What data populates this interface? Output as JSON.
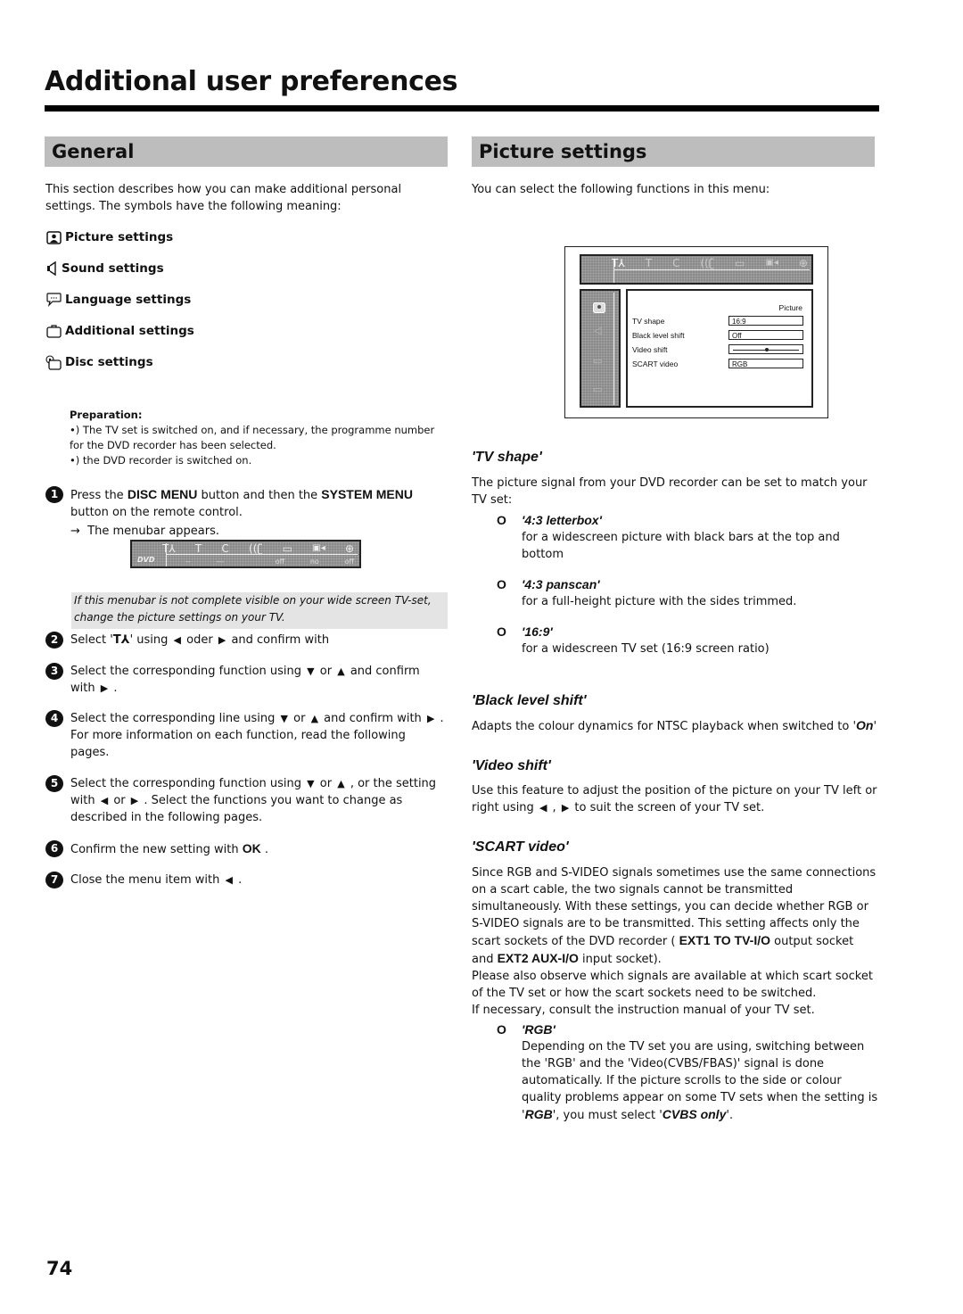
{
  "page": {
    "title": "Additional user preferences",
    "page_number": "74"
  },
  "general": {
    "heading": "General",
    "intro": "This section describes how you can make additional personal settings. The symbols have the following meaning:",
    "symbols": [
      {
        "icon": "picture-icon",
        "label": "Picture settings"
      },
      {
        "icon": "speaker-icon",
        "label": "Sound settings"
      },
      {
        "icon": "speech-bubble-icon",
        "label": "Language settings"
      },
      {
        "icon": "briefcase-icon",
        "label": "Additional settings"
      },
      {
        "icon": "disc-icon",
        "label": "Disc settings"
      }
    ],
    "preparation": {
      "label": "Preparation:",
      "lines": [
        "•) The TV set is switched on, and if necessary, the programme number for the DVD recorder has been selected.",
        "•) the DVD recorder is switched on."
      ]
    },
    "steps": [
      {
        "num": "1",
        "parts": [
          "Press the ",
          "DISC MENU",
          " button and then the ",
          "SYSTEM MENU",
          " button on the remote control."
        ],
        "result": "The menubar appears."
      },
      {
        "num": "2",
        "text_a": "Select '",
        "glyph": "T⅄",
        "text_b": "' using ",
        "left": "◀",
        "mid": " oder ",
        "right": "▶",
        "text_c": " and confirm with"
      },
      {
        "num": "3",
        "text_a": "Select the corresponding function using ",
        "down": "▼",
        "or": " or ",
        "up": "▲",
        "text_b": " and confirm with ",
        "right": "▶",
        "end": " ."
      },
      {
        "num": "4",
        "text_a": "Select the corresponding line using ",
        "down": "▼",
        "or": " or ",
        "up": "▲",
        "text_b": " and confirm with ",
        "right": "▶",
        "end": " . For more information on each function, read the following pages."
      },
      {
        "num": "5",
        "text_a": "Select the corresponding function using ",
        "down": "▼",
        "or": " or ",
        "up": "▲",
        "text_b": " , or the setting with ",
        "left": "◀",
        "or2": " or ",
        "right": "▶",
        "end": " . Select the functions you want to change as described in the following pages."
      },
      {
        "num": "6",
        "text_a": "Confirm the new setting with ",
        "key": "OK",
        "end": " ."
      },
      {
        "num": "7",
        "text_a": "Close the menu item with ",
        "left": "◀",
        "end": " ."
      }
    ],
    "result_arrow": "→",
    "note": "If this menubar is not complete visible on your wide screen TV-set, change the picture settings on your TV."
  },
  "menubar": {
    "logo": "DVD",
    "icons": [
      "settings-icon",
      "title-icon",
      "chapter-icon",
      "audio-icon",
      "subtitle-icon",
      "camera-angle-icon",
      "zoom-icon"
    ],
    "icon_glyphs": [
      "T⅄",
      "T",
      "C",
      "((ʗ",
      "▭",
      "🎥",
      "⊕"
    ],
    "values": [
      "",
      "--",
      "---",
      "",
      "off",
      "no",
      "off"
    ]
  },
  "picture": {
    "heading": "Picture settings",
    "intro": "You can select the following functions in this menu:",
    "osd": {
      "panel_title": "Picture",
      "rows": [
        {
          "label": "TV shape",
          "value": "16:9"
        },
        {
          "label": "Black level shift",
          "value": "Off"
        },
        {
          "label": "Video shift",
          "value": "",
          "slider": 0.5
        },
        {
          "label": "SCART video",
          "value": "RGB"
        }
      ]
    },
    "tv_shape": {
      "heading": "'TV shape'",
      "text": "The picture signal from your DVD recorder can be set to match your TV set:",
      "options": [
        {
          "bullet": "O",
          "name": "'4:3 letterbox'",
          "desc": "for a widescreen picture with black bars at the top and bottom"
        },
        {
          "bullet": "O",
          "name": "'4:3 panscan'",
          "desc": "for a full-height picture with the sides trimmed."
        },
        {
          "bullet": "O",
          "name": "'16:9'",
          "desc": "for a widescreen TV set (16:9 screen ratio)"
        }
      ]
    },
    "black_level": {
      "heading": "'Black level shift'",
      "text": "Adapts the colour dynamics for NTSC playback when switched to '",
      "value": "On",
      "end": "'"
    },
    "video_shift": {
      "heading": "'Video shift'",
      "text_a": "Use this feature to adjust the position of the picture on your TV left or right using ",
      "left": "◀",
      "sep": " , ",
      "right": "▶",
      "text_b": " to suit the screen of your TV set."
    },
    "scart": {
      "heading": "'SCART video'",
      "p1_a": "Since RGB and S-VIDEO signals sometimes use the same connections on a scart cable, the two signals cannot be transmitted simultaneously. With these settings, you can decide whether RGB or S-VIDEO signals are to be transmitted. This setting affects only the scart sockets of the DVD recorder ( ",
      "socket1": "EXT1 TO TV-I/O",
      "p1_b": " output socket and ",
      "socket2": "EXT2 AUX-I/O",
      "p1_c": " input socket).",
      "p2": "Please also observe which signals are available at which scart socket of the TV set or how the scart sockets need to be switched.",
      "p3": "If necessary, consult the instruction manual of your TV set.",
      "option": {
        "bullet": "O",
        "name": "'RGB'",
        "desc_a": "Depending on the TV set you are using, switching between the 'RGB' and the 'Video(CVBS/FBAS)' signal is done automatically. If the picture scrolls to the side or colour quality problems appear on some TV sets when the setting is '",
        "rgb": "RGB",
        "desc_b": "', you must select '",
        "cvbs": "CVBS only",
        "desc_c": "'."
      }
    }
  }
}
